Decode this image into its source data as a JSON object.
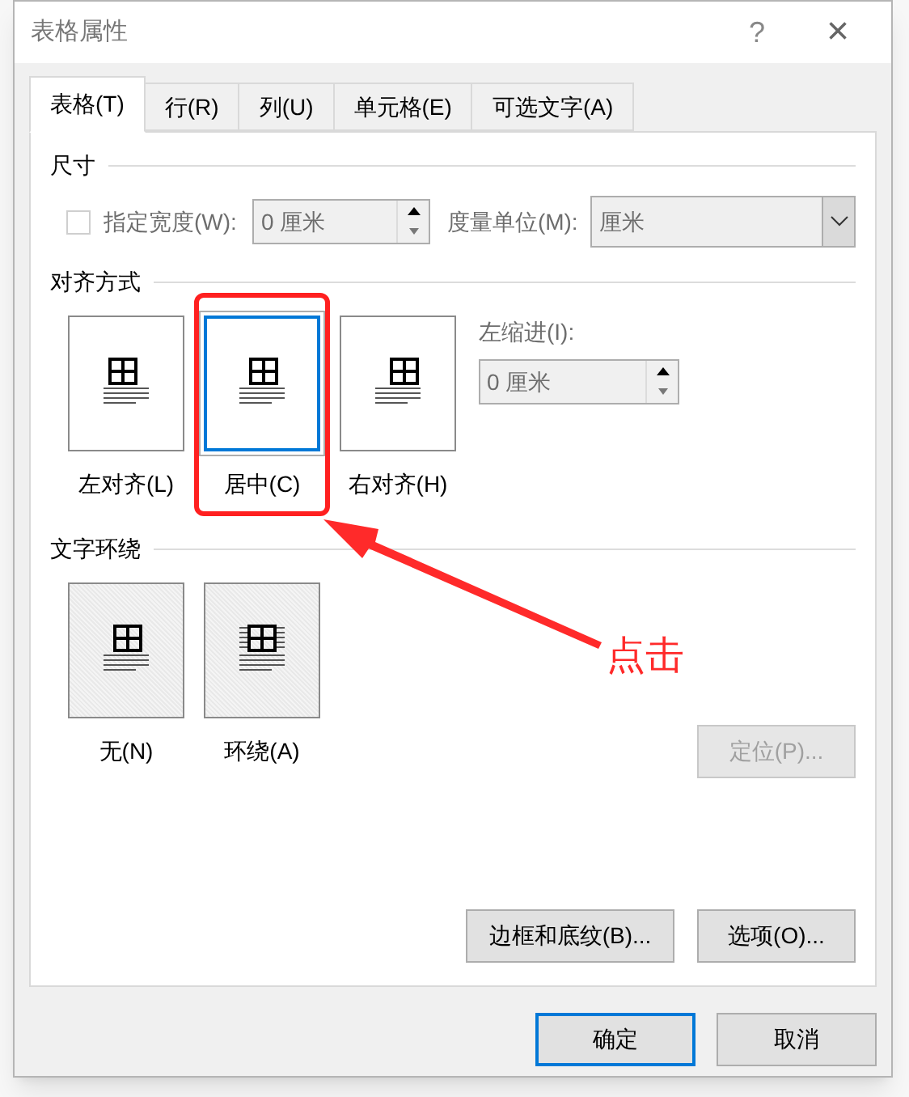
{
  "window": {
    "title": "表格属性",
    "help": "?",
    "close": "×"
  },
  "tabs": [
    {
      "label": "表格(T)",
      "selected": true
    },
    {
      "label": "行(R)",
      "selected": false
    },
    {
      "label": "列(U)",
      "selected": false
    },
    {
      "label": "单元格(E)",
      "selected": false
    },
    {
      "label": "可选文字(A)",
      "selected": false
    }
  ],
  "size": {
    "heading": "尺寸",
    "width_checkbox": {
      "label": "指定宽度(W):",
      "checked": false,
      "disabled": true
    },
    "width_field": {
      "value": "0 厘米",
      "disabled": true
    },
    "unit_label": "度量单位(M):",
    "unit_select": {
      "value": "厘米",
      "disabled": true
    }
  },
  "alignment": {
    "heading": "对齐方式",
    "options": [
      {
        "kind": "left",
        "label": "左对齐(L)",
        "selected": false
      },
      {
        "kind": "center",
        "label": "居中(C)",
        "selected": true
      },
      {
        "kind": "right",
        "label": "右对齐(H)",
        "selected": false
      }
    ],
    "indent_label": "左缩进(I):",
    "indent_field": {
      "value": "0 厘米",
      "disabled": true
    }
  },
  "wrapping": {
    "heading": "文字环绕",
    "disabled": true,
    "options": [
      {
        "kind": "none",
        "label": "无(N)",
        "selected": false
      },
      {
        "kind": "around",
        "label": "环绕(A)",
        "selected": false
      }
    ],
    "position_button": {
      "label": "定位(P)...",
      "disabled": true
    }
  },
  "panel_buttons": [
    "边框和底纹(B)...",
    "选项(O)..."
  ],
  "annotation": {
    "label": "点击"
  },
  "footer_buttons": [
    {
      "label": "确定",
      "default": true
    },
    {
      "label": "取消",
      "default": false
    }
  ]
}
